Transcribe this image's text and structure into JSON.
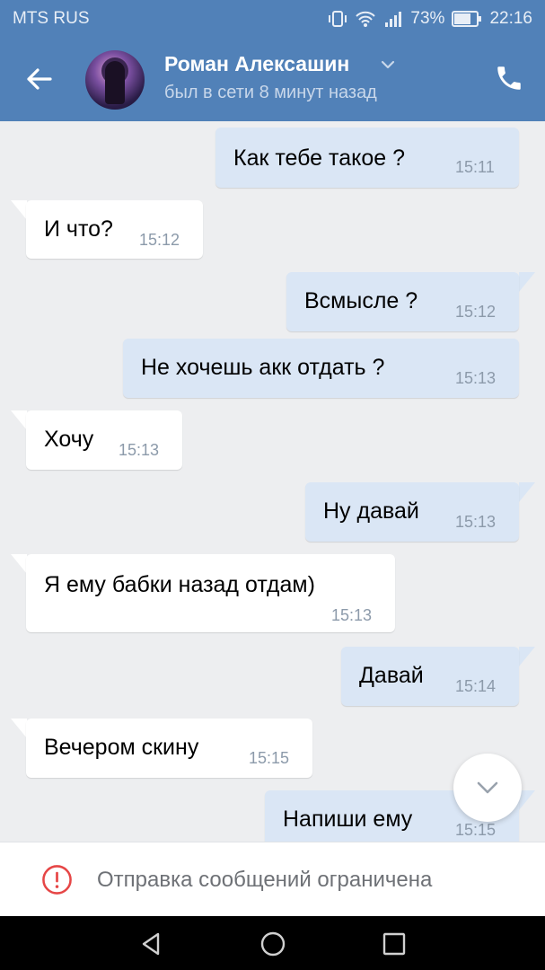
{
  "status": {
    "carrier": "MTS RUS",
    "battery": "73%",
    "time": "22:16"
  },
  "header": {
    "name": "Роман Алексашин",
    "last_seen": "был в сети 8 минут назад"
  },
  "messages": [
    {
      "dir": "out",
      "text": "Как тебе такое ?",
      "time": "15:11"
    },
    {
      "dir": "in",
      "text": "И что?",
      "time": "15:12"
    },
    {
      "dir": "out",
      "text": "Всмысле ?",
      "time": "15:12"
    },
    {
      "dir": "out",
      "text": "Не хочешь акк отдать ?",
      "time": "15:13"
    },
    {
      "dir": "in",
      "text": "Хочу",
      "time": "15:13"
    },
    {
      "dir": "out",
      "text": "Ну давай",
      "time": "15:13"
    },
    {
      "dir": "in",
      "text": "Я ему бабки назад отдам)",
      "time": "15:13"
    },
    {
      "dir": "out",
      "text": "Давай",
      "time": "15:14"
    },
    {
      "dir": "in",
      "text": "Вечером скину",
      "time": "15:15"
    },
    {
      "dir": "out",
      "text": "Напиши ему",
      "time": "15:15"
    }
  ],
  "footer": {
    "restricted_text": "Отправка сообщений ограничена"
  },
  "colors": {
    "header_bg": "#5181b8",
    "outgoing_bubble": "#dae6f5",
    "incoming_bubble": "#ffffff",
    "chat_bg": "#edeef0",
    "warning": "#e64646"
  }
}
